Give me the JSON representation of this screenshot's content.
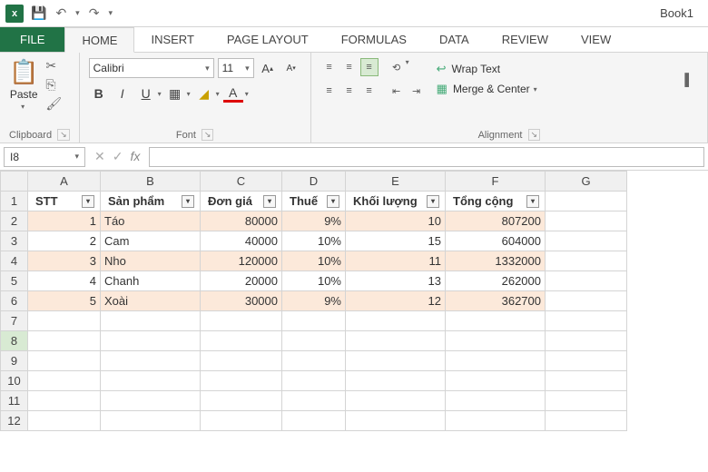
{
  "titlebar": {
    "doc_title": "Book1"
  },
  "tabs": {
    "file": "FILE",
    "home": "HOME",
    "insert": "INSERT",
    "page_layout": "PAGE LAYOUT",
    "formulas": "FORMULAS",
    "data": "DATA",
    "review": "REVIEW",
    "view": "VIEW"
  },
  "clipboard": {
    "paste": "Paste",
    "label": "Clipboard"
  },
  "font": {
    "name": "Calibri",
    "size": "11",
    "label": "Font"
  },
  "alignment": {
    "wrap": "Wrap Text",
    "merge": "Merge & Center",
    "label": "Alignment"
  },
  "namebox": "I8",
  "columns": [
    "A",
    "B",
    "C",
    "D",
    "E",
    "F",
    "G"
  ],
  "headers": {
    "stt": "STT",
    "sanpham": "Sản phẩm",
    "dongia": "Đơn giá",
    "thue": "Thuế",
    "khoiluong": "Khối lượng",
    "tongcong": "Tổng cộng"
  },
  "rows": [
    {
      "n": "1",
      "stt": "1",
      "sp": "Táo",
      "dg": "80000",
      "th": "9%",
      "kl": "10",
      "tc": "807200"
    },
    {
      "n": "2",
      "stt": "2",
      "sp": "Cam",
      "dg": "40000",
      "th": "10%",
      "kl": "15",
      "tc": "604000"
    },
    {
      "n": "3",
      "stt": "3",
      "sp": "Nho",
      "dg": "120000",
      "th": "10%",
      "kl": "11",
      "tc": "1332000"
    },
    {
      "n": "4",
      "stt": "4",
      "sp": "Chanh",
      "dg": "20000",
      "th": "10%",
      "kl": "13",
      "tc": "262000"
    },
    {
      "n": "5",
      "stt": "5",
      "sp": "Xoài",
      "dg": "30000",
      "th": "9%",
      "kl": "12",
      "tc": "362700"
    }
  ],
  "chart_data": {
    "type": "table",
    "columns": [
      "STT",
      "Sản phẩm",
      "Đơn giá",
      "Thuế",
      "Khối lượng",
      "Tổng cộng"
    ],
    "data": [
      [
        1,
        "Táo",
        80000,
        "9%",
        10,
        807200
      ],
      [
        2,
        "Cam",
        40000,
        "10%",
        15,
        604000
      ],
      [
        3,
        "Nho",
        120000,
        "10%",
        11,
        1332000
      ],
      [
        4,
        "Chanh",
        20000,
        "10%",
        13,
        262000
      ],
      [
        5,
        "Xoài",
        30000,
        "9%",
        12,
        362700
      ]
    ]
  }
}
